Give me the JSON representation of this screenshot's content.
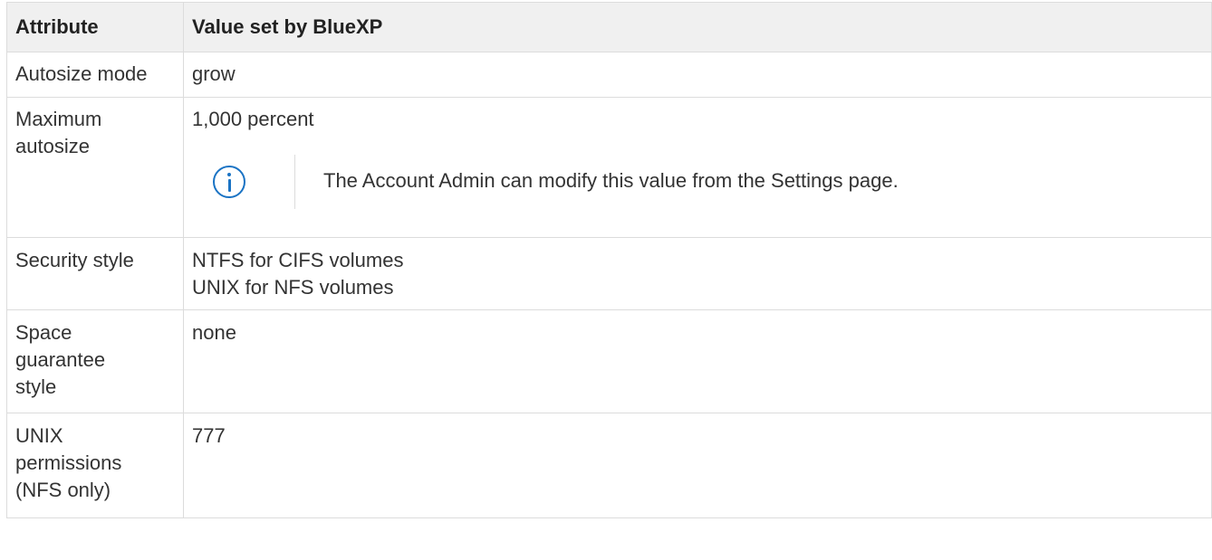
{
  "table": {
    "headers": [
      "Attribute",
      "Value set by BlueXP"
    ],
    "rows": {
      "autosize_mode": {
        "attribute": "Autosize mode",
        "value": "grow"
      },
      "maximum_autosize": {
        "attribute_lines": [
          "Maximum",
          "autosize"
        ],
        "value": "1,000 percent",
        "note": "The Account Admin can modify this value from the Settings page."
      },
      "security_style": {
        "attribute": "Security style",
        "value_lines": [
          "NTFS for CIFS volumes",
          "UNIX for NFS volumes"
        ]
      },
      "space_guarantee": {
        "attribute_lines": [
          "Space",
          "guarantee",
          "style"
        ],
        "value": "none"
      },
      "unix_permissions": {
        "attribute_lines": [
          "UNIX",
          "permissions",
          "(NFS only)"
        ],
        "value": "777"
      }
    }
  },
  "colors": {
    "header_bg": "#f0f0f0",
    "border": "#dcdcdc",
    "text": "#333333",
    "info_icon": "#1a73c4"
  },
  "icons": {
    "note_icon": "info-circle-icon"
  }
}
